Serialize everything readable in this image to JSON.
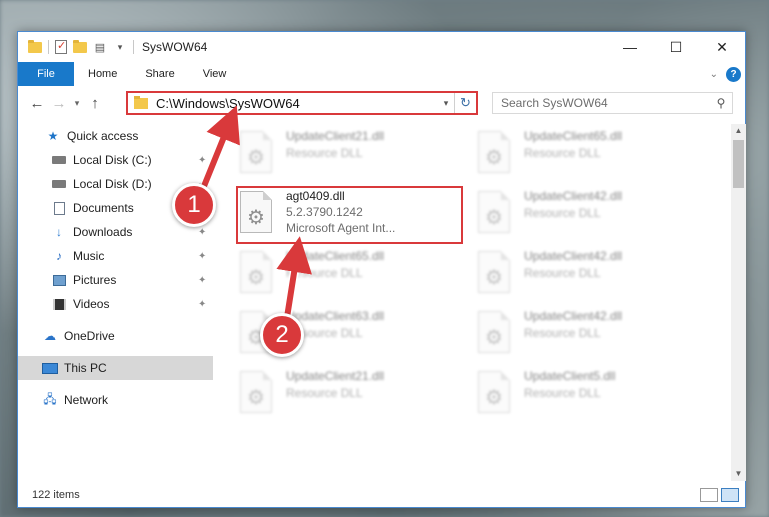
{
  "window": {
    "title": "SysWOW64",
    "controls": {
      "minimize": "—",
      "maximize": "☐",
      "close": "✕"
    }
  },
  "ribbon": {
    "tabs": [
      {
        "label": "File",
        "active": true
      },
      {
        "label": "Home"
      },
      {
        "label": "Share"
      },
      {
        "label": "View"
      }
    ],
    "expand_icon": "chevron-down-icon",
    "help_label": "?"
  },
  "navbar": {
    "address": "C:\\Windows\\SysWOW64",
    "search_placeholder": "Search SysWOW64"
  },
  "sidebar": {
    "items": [
      {
        "label": "Quick access",
        "icon": "star-icon"
      },
      {
        "label": "Local Disk (C:)",
        "icon": "disk-icon",
        "pinned": true
      },
      {
        "label": "Local Disk (D:)",
        "icon": "disk-icon",
        "pinned": true
      },
      {
        "label": "Documents",
        "icon": "documents-icon",
        "pinned": true
      },
      {
        "label": "Downloads",
        "icon": "download-icon",
        "pinned": true
      },
      {
        "label": "Music",
        "icon": "music-icon",
        "pinned": true
      },
      {
        "label": "Pictures",
        "icon": "pictures-icon",
        "pinned": true
      },
      {
        "label": "Videos",
        "icon": "videos-icon",
        "pinned": true
      },
      {
        "label": "OneDrive",
        "icon": "cloud-icon"
      },
      {
        "label": "This PC",
        "icon": "computer-icon",
        "selected": true
      },
      {
        "label": "Network",
        "icon": "network-icon"
      }
    ]
  },
  "files": [
    {
      "name": "UpdateClient21.dll",
      "type": "Resource DLL",
      "blurred": true
    },
    {
      "name": "UpdateClient65.dll",
      "type": "Resource DLL",
      "blurred": true
    },
    {
      "name": "agt0409.dll",
      "version": "5.2.3790.1242",
      "type": "Microsoft Agent Int...",
      "highlighted": true
    },
    {
      "name": "UpdateClient42.dll",
      "type": "Resource DLL",
      "blurred": true
    },
    {
      "name": "UpdateClient65.dll",
      "type": "Resource DLL",
      "blurred": true
    },
    {
      "name": "UpdateClient42.dll",
      "type": "Resource DLL",
      "blurred": true
    },
    {
      "name": "UpdateClient63.dll",
      "type": "Resource DLL",
      "blurred": true
    },
    {
      "name": "UpdateClient42.dll",
      "type": "Resource DLL",
      "blurred": true
    },
    {
      "name": "UpdateClient21.dll",
      "type": "Resource DLL",
      "blurred": true
    },
    {
      "name": "UpdateClient5.dll",
      "type": "Resource DLL",
      "blurred": true
    }
  ],
  "status": {
    "item_count": "122 items"
  },
  "annotations": {
    "step1": "1",
    "step2": "2",
    "color": "#d9393b"
  }
}
